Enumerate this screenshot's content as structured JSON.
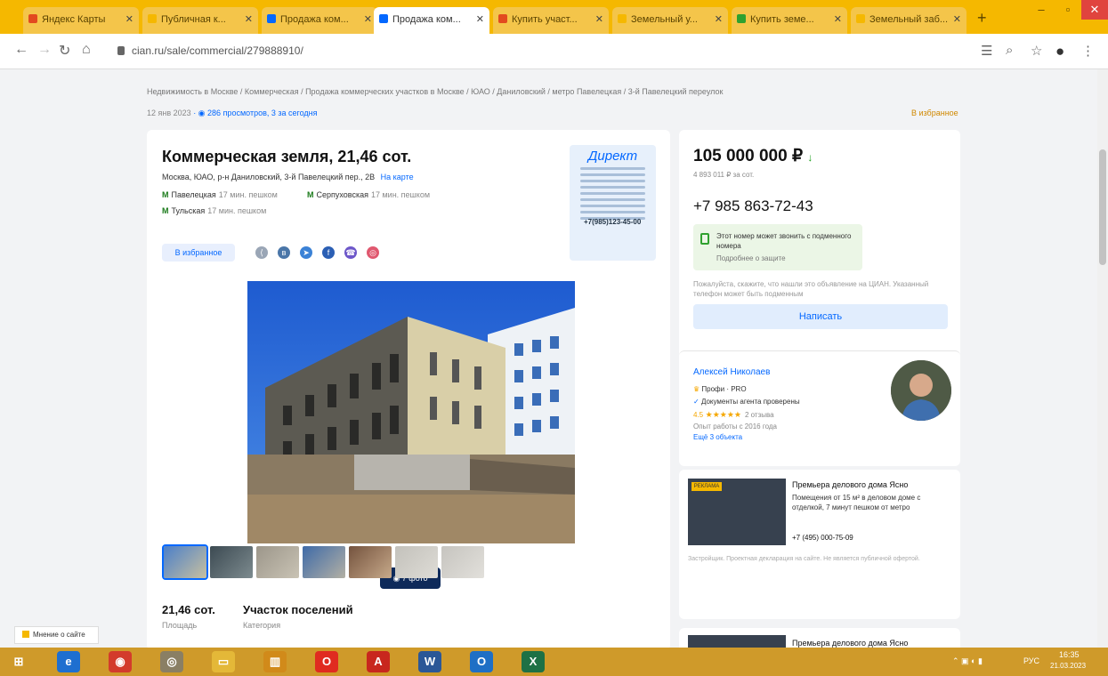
{
  "browser": {
    "tabs": [
      {
        "label": "Яндекс Карты",
        "color": "#e24a1f",
        "active": false
      },
      {
        "label": "Публичная к...",
        "color": "#f5b800",
        "active": false
      },
      {
        "label": "Продажа ком...",
        "color": "#0468ff",
        "active": false
      },
      {
        "label": "Продажа ком...",
        "color": "#0468ff",
        "active": true
      },
      {
        "label": "Купить участ...",
        "color": "#e24a1f",
        "active": false
      },
      {
        "label": "Земельный у...",
        "color": "#f5b800",
        "active": false
      },
      {
        "label": "Купить земе...",
        "color": "#2fa12f",
        "active": false
      },
      {
        "label": "Земельный заб...",
        "color": "#f5b800",
        "active": false
      }
    ],
    "new_tab": "+",
    "url": "cian.ru/sale/commercial/279888910/"
  },
  "breadcrumbs": "Недвижимость в Москве / Коммерческая / Продажа коммерческих участков в Москве / ЮАО / Даниловский / метро Павелецкая / 3-й Павелецкий переулок",
  "meta": {
    "date": "12 янв 2023",
    "views": "286 просмотров, 3 за сегодня",
    "favorite": "В избранное"
  },
  "listing": {
    "title": "Коммерческая земля, 21,46 сот.",
    "address": "Москва, ЮАО, р-н Даниловский, 3-й Павелецкий пер., 2В",
    "on_map": "На карте",
    "metro": [
      {
        "name": "Павелецкая",
        "dist": "17 мин. пешком"
      },
      {
        "name": "Серпуховская",
        "dist": "17 мин. пешком"
      },
      {
        "name": "Тульская",
        "dist": "17 мин. пешком"
      }
    ],
    "favorite_btn": "В избранное",
    "ad": {
      "brand": "Директ",
      "phone": "+7(985)123-45-00"
    },
    "photo_count": "7 фото",
    "stats": [
      {
        "value": "21,46 сот.",
        "label": "Площадь"
      },
      {
        "value": "Участок поселений",
        "label": "Категория"
      }
    ]
  },
  "sidebar": {
    "price": "105 000 000 ₽",
    "price_per": "4 893 011 ₽ за сот.",
    "phone": "+7 985 863-72-43",
    "notice_title": "Этот номер может звонить с подменного номера",
    "notice_sub": "Подробнее о защите",
    "hint": "Пожалуйста, скажите, что нашли это объявление на ЦИАН. Указанный телефон может быть подменным",
    "write_btn": "Написать",
    "agent": {
      "name": "Алексей Николаев",
      "pro": "Профи · PRO",
      "docs": "Документы агента проверены",
      "rating": "4.5",
      "reviews": "2 отзыва",
      "experience": "Опыт работы с 2016 года",
      "more": "Ещё 3 объекта"
    },
    "promo": {
      "badge": "РЕКЛАМА",
      "title": "Премьера делового дома Ясно",
      "desc": "Помещения от 15 м² в деловом доме с отделкой, 7 минут пешком от метро",
      "phone": "+7 (495) 000-75-09",
      "foot": "Застройщик. Проектная декларация на сайте. Не является публичной офертой."
    },
    "promo2_title": "Премьера делового дома Ясно"
  },
  "feedback": "Мнение о сайте",
  "taskbar": {
    "lang": "РУС",
    "time": "16:35",
    "date": "21.03.2023"
  }
}
